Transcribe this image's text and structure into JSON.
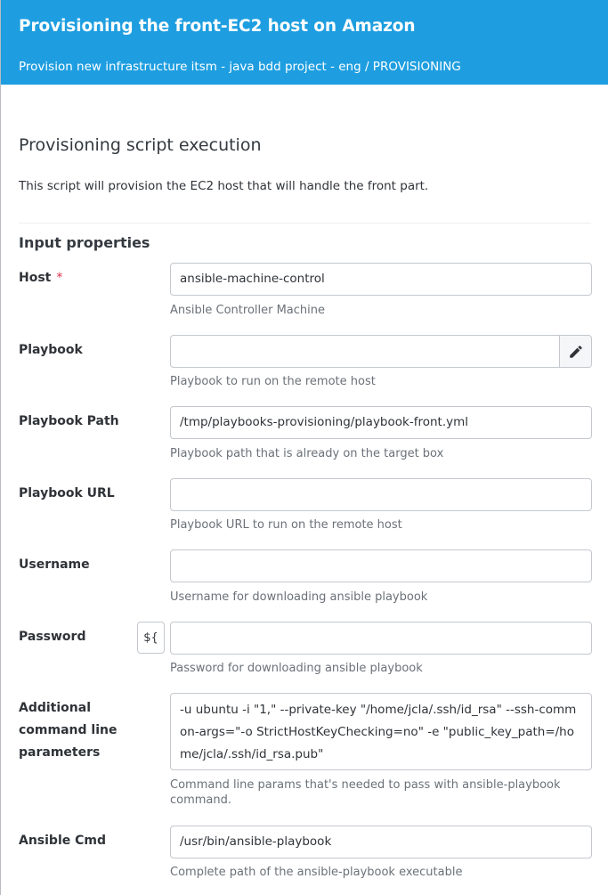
{
  "header": {
    "title": "Provisioning the front-EC2 host on Amazon",
    "subtitle": "Provision new infrastructure itsm - java bdd project - eng / PROVISIONING"
  },
  "section": {
    "title": "Provisioning script execution",
    "description": "This script will provision the EC2 host that will handle the front part."
  },
  "input_properties": {
    "title": "Input properties",
    "required_mark": "*",
    "variable_button": "${",
    "fields": [
      {
        "label": "Host",
        "value": "ansible-machine-control",
        "hint": "Ansible Controller Machine"
      },
      {
        "label": "Playbook",
        "value": "",
        "hint": "Playbook to run on the remote host"
      },
      {
        "label": "Playbook Path",
        "value": "/tmp/playbooks-provisioning/playbook-front.yml",
        "hint": "Playbook path that is already on the target box"
      },
      {
        "label": "Playbook URL",
        "value": "",
        "hint": "Playbook URL to run on the remote host"
      },
      {
        "label": "Username",
        "value": "",
        "hint": "Username for downloading ansible playbook"
      },
      {
        "label": "Password",
        "value": "",
        "hint": "Password for downloading ansible playbook"
      },
      {
        "label": "Additional command line parameters",
        "value": "-u ubuntu -i \"1,\" --private-key \"/home/jcla/.ssh/id_rsa\" --ssh-common-args=\"-o StrictHostKeyChecking=no\" -e \"public_key_path=/home/jcla/.ssh/id_rsa.pub\"",
        "hint": "Command line params that's needed to pass with ansible-playbook command."
      },
      {
        "label": "Ansible Cmd",
        "value": "/usr/bin/ansible-playbook",
        "hint": "Complete path of the ansible-playbook executable"
      }
    ]
  },
  "colors": {
    "header_bg": "#1e9ee0",
    "required": "#d9314a"
  },
  "icons": {
    "edit": "pencil-icon"
  }
}
